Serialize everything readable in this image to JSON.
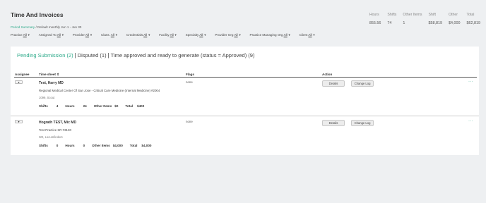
{
  "header": {
    "title": "Time And Invoices",
    "breadcrumb_link": "Period Summary",
    "breadcrumb_rest": "/ Default monthly Jun 1 - Jun 30"
  },
  "stats": [
    {
      "label": "Hours",
      "value": "855.56"
    },
    {
      "label": "Shifts",
      "value": "74"
    },
    {
      "label": "Other Items",
      "value": "1"
    },
    {
      "label": "Shift",
      "value": "$58,819"
    },
    {
      "label": "Other",
      "value": "$4,000"
    },
    {
      "label": "Total",
      "value": "$62,819"
    }
  ],
  "filters": [
    {
      "label": "Practice",
      "value": "All"
    },
    {
      "label": "Assigned To",
      "value": "All"
    },
    {
      "label": "Provider",
      "value": "All"
    },
    {
      "label": "Class.",
      "value": "All"
    },
    {
      "label": "Credentials",
      "value": "All"
    },
    {
      "label": "Facility",
      "value": "All"
    },
    {
      "label": "Specialty",
      "value": "All"
    },
    {
      "label": "Provider Org",
      "value": "All"
    },
    {
      "label": "Practice Managing Org",
      "value": "All"
    },
    {
      "label": "Client",
      "value": "All"
    }
  ],
  "tabs": {
    "pending": "Pending Submission (2)",
    "disputed": "Disputed (1)",
    "approved": "Time approved and ready to generate (status = Approved) (9)"
  },
  "columns": {
    "assignee": "Assignee",
    "timesheet": "Time sheet",
    "sort_icon": "sort-icon",
    "flags": "Flags",
    "action": "Action"
  },
  "rows": [
    {
      "name": "Test, Harry MD",
      "facility": "Regional Medical Center Of San Jose - Critical Care Medicine (Internal Medicine) #2004",
      "worker_type": "1099, Scout",
      "flag": "none",
      "details_label": "Details",
      "log_label": "Change Log",
      "shifts_label": "Shifts",
      "shifts": "4",
      "hours_label": "Hours",
      "hours": "24",
      "other_label": "Other Items",
      "other": "$0",
      "total_label": "Total",
      "total": "$400"
    },
    {
      "name": "Hograth TEST, Mic MD",
      "facility": "Test Practice SR #3130",
      "worker_type": "W2, Locumfinders",
      "flag": "none",
      "details_label": "Details",
      "log_label": "Change Log",
      "shifts_label": "Shifts",
      "shifts": "0",
      "hours_label": "Hours",
      "hours": "0",
      "other_label": "Other Items",
      "other": "$4,000",
      "total_label": "Total",
      "total": "$4,000"
    }
  ],
  "colors": {
    "accent": "#2eaa8a",
    "background": "#eef0f2",
    "panel": "#ffffff"
  }
}
